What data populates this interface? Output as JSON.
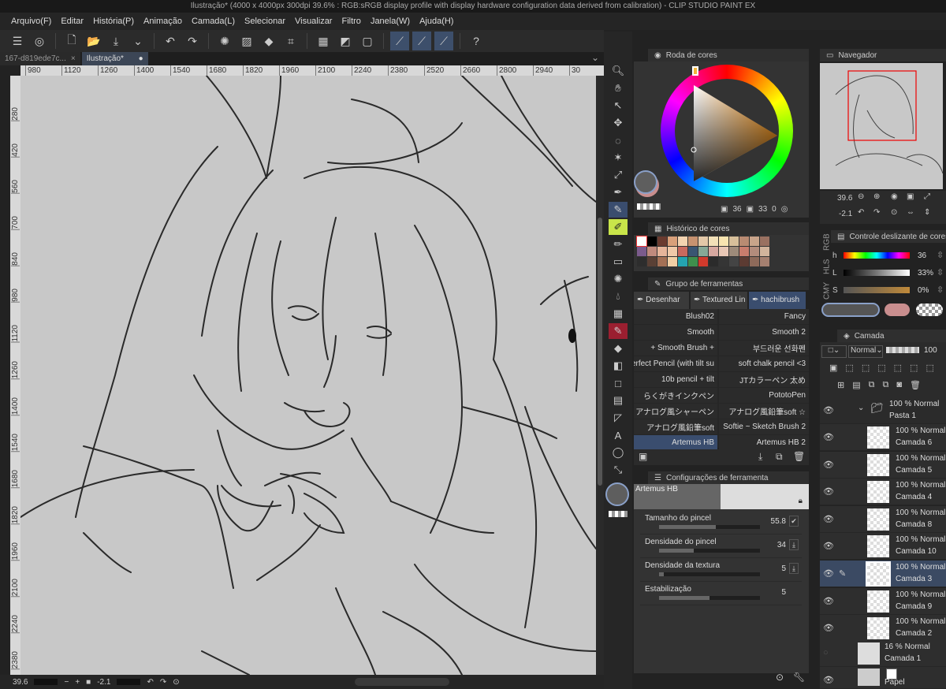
{
  "window": {
    "title": "Ilustração* (4000 x 4000px 300dpi 39.6% : RGB:sRGB display profile with display hardware configuration data derived from calibration) - CLIP STUDIO PAINT EX"
  },
  "menu": [
    "Arquivo(F)",
    "Editar",
    "História(P)",
    "Animação",
    "Camada(L)",
    "Selecionar",
    "Visualizar",
    "Filtro",
    "Janela(W)",
    "Ajuda(H)"
  ],
  "toolbar_icons": [
    "menu-icon",
    "clip-studio-icon",
    "new-file-icon",
    "open-folder-icon",
    "save-icon",
    "chevron-down-icon",
    "undo-icon",
    "redo-icon",
    "loading-icon",
    "clear-icon",
    "fill-icon",
    "transform-icon",
    "hide-selection-icon",
    "contrast-icon",
    "border-icon",
    "pen-icon",
    "smooth-pen-icon",
    "pen-correct-icon",
    "help-icon"
  ],
  "tabs": [
    {
      "label": "167-d819ede7c...",
      "close": "×"
    },
    {
      "label": "Ilustração*",
      "close": "●"
    }
  ],
  "ruler_h": [
    "980",
    "1120",
    "1260",
    "1400",
    "1540",
    "1680",
    "1820",
    "1960",
    "2100",
    "2240",
    "2380",
    "2520",
    "2660",
    "2800",
    "2940",
    "30"
  ],
  "ruler_v": [
    "280",
    "420",
    "560",
    "700",
    "840",
    "980",
    "1120",
    "1260",
    "1400",
    "1540",
    "1680",
    "1820",
    "1960",
    "2100",
    "2240",
    "2380"
  ],
  "status": {
    "zoom": "39.6",
    "minus": "−",
    "plus": "+",
    "angle": "-2.1"
  },
  "color_wheel": {
    "title": "Roda de cores",
    "hue": "36",
    "saturation": "33",
    "value": "0",
    "main_color": "#5e5e5e",
    "sub_color": "#c98e8e"
  },
  "color_history": {
    "title": "Histórico de cores",
    "colors": [
      "#ffffff",
      "#000000",
      "#6a3b2f",
      "#d9a07a",
      "#f3d3b0",
      "#c79270",
      "#e3c8a8",
      "#f2e0b8",
      "#f8e4b0",
      "#d7bf9a",
      "#b98b72",
      "#c8a48a",
      "#9a7161",
      "#7b5b8c",
      "#c08a7d",
      "#e6b59a",
      "#f0c9a8",
      "#c9695e",
      "#3a5572",
      "#86a896",
      "#d7a8a0",
      "#e8c7b5",
      "#9e8b7a",
      "#c97d6d",
      "#b38c7c",
      "#d2b49c",
      "#2d2d2d",
      "#5a4035",
      "#a47055",
      "#f1cfa5",
      "#24a4b0",
      "#3f8f4d",
      "#d13a2c",
      "#2b2b2b",
      "#353535",
      "#444444",
      "#5c3b32",
      "#8e6a5a",
      "#a58070"
    ]
  },
  "tool_group": {
    "title": "Grupo de ferramentas",
    "tabs": [
      "Desenhar",
      "Textured Lin",
      "hachibrush"
    ],
    "brushes": [
      [
        "Blush02",
        "Fancy"
      ],
      [
        "Smooth",
        "Smooth 2"
      ],
      [
        "+ Smooth Brush +",
        "부드러운 선화펜"
      ],
      [
        "Perfect Pencil (with tilt su",
        "soft chalk pencil <3"
      ],
      [
        "10b pencil + tilt",
        "JTカラーペン 太め"
      ],
      [
        "らくがきインクペン",
        "PototoPen"
      ],
      [
        "アナログ風シャーペン",
        "アナログ風鉛筆soft ☆"
      ],
      [
        "アナログ風鉛筆soft",
        "Softie ~ Sketch Brush 2"
      ],
      [
        "Artemus HB",
        "Artemus HB 2"
      ]
    ]
  },
  "tool_settings": {
    "title": "Configurações de ferramenta",
    "brush_name": "Artemus HB",
    "rows": [
      {
        "label": "Tamanho do pincel",
        "value": "55.8",
        "fill": 0.56
      },
      {
        "label": "Densidade do pincel",
        "value": "34",
        "fill": 0.34
      },
      {
        "label": "Densidade da textura",
        "value": "5",
        "fill": 0.05
      },
      {
        "label": "Estabilização",
        "value": "5",
        "fill": 0.5
      }
    ]
  },
  "navigator": {
    "title": "Navegador",
    "zoom": "39.6",
    "angle": "-2.1"
  },
  "color_slider": {
    "title": "Controle deslizante de cores",
    "tabs": [
      "RGB",
      "HLS",
      "CMY"
    ],
    "h": {
      "label": "h",
      "value": "36"
    },
    "l": {
      "label": "L",
      "value": "33%"
    },
    "s": {
      "label": "S",
      "value": "0%"
    }
  },
  "layers": {
    "title": "Camada",
    "blend": "Normal",
    "opacity": "100",
    "folder": {
      "l1": "100 % Normal",
      "l2": "Pasta 1"
    },
    "items": [
      {
        "l1": "100 % Normal",
        "l2": "Camada 6"
      },
      {
        "l1": "100 % Normal",
        "l2": "Camada 5"
      },
      {
        "l1": "100 % Normal",
        "l2": "Camada 4"
      },
      {
        "l1": "100 % Normal",
        "l2": "Camada 8"
      },
      {
        "l1": "100 % Normal",
        "l2": "Camada 10"
      },
      {
        "l1": "100 % Normal",
        "l2": "Camada 3"
      },
      {
        "l1": "100 % Normal",
        "l2": "Camada 9"
      },
      {
        "l1": "100 % Normal",
        "l2": "Camada 2"
      }
    ],
    "bottom": [
      {
        "l1": "16 % Normal",
        "l2": "Camada 1"
      },
      {
        "l1": "",
        "l2": "Papel"
      }
    ]
  }
}
